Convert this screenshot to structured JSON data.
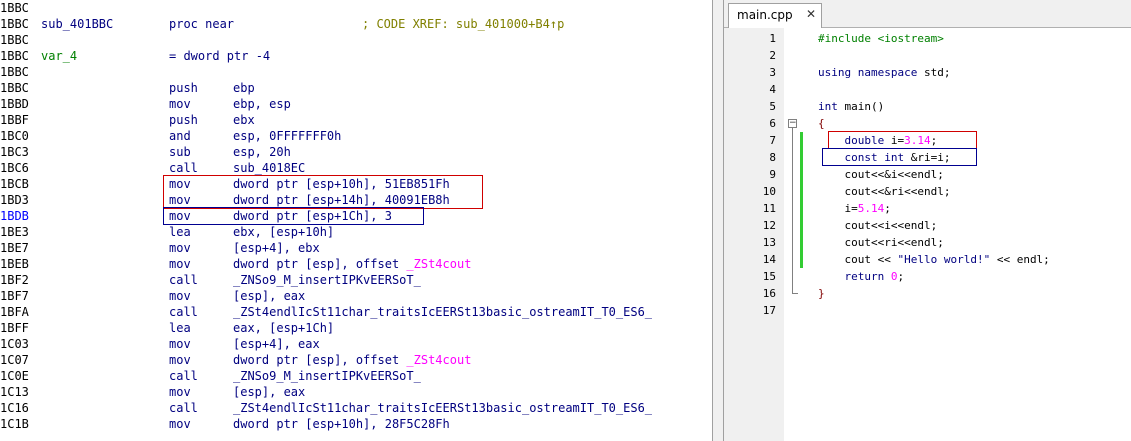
{
  "disassembly": {
    "rows": [
      {
        "addr": "1BBC",
        "label": "",
        "mnemonic": "",
        "operands": "",
        "comment": "",
        "label_type": "none"
      },
      {
        "addr": "1BBC",
        "label": "sub_401BBC",
        "mnemonic": "proc near",
        "operands": "",
        "comment": "; CODE XREF: sub_401000+B4↑p",
        "label_type": "proc"
      },
      {
        "addr": "1BBC",
        "label": "",
        "mnemonic": "",
        "operands": "",
        "comment": "",
        "label_type": "none"
      },
      {
        "addr": "1BBC",
        "label": "var_4",
        "mnemonic": "= dword ptr -4",
        "operands": "",
        "comment": "",
        "label_type": "var"
      },
      {
        "addr": "1BBC",
        "label": "",
        "mnemonic": "",
        "operands": "",
        "comment": "",
        "label_type": "none"
      },
      {
        "addr": "1BBC",
        "label": "",
        "mnemonic": "push",
        "operands": "ebp",
        "comment": "",
        "label_type": "none"
      },
      {
        "addr": "1BBD",
        "label": "",
        "mnemonic": "mov",
        "operands": "ebp, esp",
        "comment": "",
        "label_type": "none"
      },
      {
        "addr": "1BBF",
        "label": "",
        "mnemonic": "push",
        "operands": "ebx",
        "comment": "",
        "label_type": "none"
      },
      {
        "addr": "1BC0",
        "label": "",
        "mnemonic": "and",
        "operands": "esp, 0FFFFFFF0h",
        "comment": "",
        "label_type": "none"
      },
      {
        "addr": "1BC3",
        "label": "",
        "mnemonic": "sub",
        "operands": "esp, 20h",
        "comment": "",
        "label_type": "none"
      },
      {
        "addr": "1BC6",
        "label": "",
        "mnemonic": "call",
        "operands": "sub_4018EC",
        "comment": "",
        "label_type": "none"
      },
      {
        "addr": "1BCB",
        "label": "",
        "mnemonic": "mov",
        "operands": "dword ptr [esp+10h], 51EB851Fh",
        "comment": "",
        "label_type": "none"
      },
      {
        "addr": "1BD3",
        "label": "",
        "mnemonic": "mov",
        "operands": "dword ptr [esp+14h], 40091EB8h",
        "comment": "",
        "label_type": "none"
      },
      {
        "addr": "1BDB",
        "label": "",
        "mnemonic": "mov",
        "operands": "dword ptr [esp+1Ch], 3",
        "comment": "",
        "label_type": "none",
        "addr_blue": true
      },
      {
        "addr": "1BE3",
        "label": "",
        "mnemonic": "lea",
        "operands": "ebx, [esp+10h]",
        "comment": "",
        "label_type": "none"
      },
      {
        "addr": "1BE7",
        "label": "",
        "mnemonic": "mov",
        "operands": "[esp+4], ebx",
        "comment": "",
        "label_type": "none"
      },
      {
        "addr": "1BEB",
        "label": "",
        "mnemonic": "mov",
        "operands": "dword ptr [esp], offset ",
        "import": "_ZSt4cout",
        "comment": "",
        "label_type": "none"
      },
      {
        "addr": "1BF2",
        "label": "",
        "mnemonic": "call",
        "operands": "_ZNSo9_M_insertIPKvEERSoT_",
        "comment": "",
        "label_type": "none"
      },
      {
        "addr": "1BF7",
        "label": "",
        "mnemonic": "mov",
        "operands": "[esp], eax",
        "comment": "",
        "label_type": "none"
      },
      {
        "addr": "1BFA",
        "label": "",
        "mnemonic": "call",
        "operands": "_ZSt4endlIcSt11char_traitsIcEERSt13basic_ostreamIT_T0_ES6_",
        "comment": "",
        "label_type": "none"
      },
      {
        "addr": "1BFF",
        "label": "",
        "mnemonic": "lea",
        "operands": "eax, [esp+1Ch]",
        "comment": "",
        "label_type": "none"
      },
      {
        "addr": "1C03",
        "label": "",
        "mnemonic": "mov",
        "operands": "[esp+4], eax",
        "comment": "",
        "label_type": "none"
      },
      {
        "addr": "1C07",
        "label": "",
        "mnemonic": "mov",
        "operands": "dword ptr [esp], offset ",
        "import": "_ZSt4cout",
        "comment": "",
        "label_type": "none"
      },
      {
        "addr": "1C0E",
        "label": "",
        "mnemonic": "call",
        "operands": "_ZNSo9_M_insertIPKvEERSoT_",
        "comment": "",
        "label_type": "none"
      },
      {
        "addr": "1C13",
        "label": "",
        "mnemonic": "mov",
        "operands": "[esp], eax",
        "comment": "",
        "label_type": "none"
      },
      {
        "addr": "1C16",
        "label": "",
        "mnemonic": "call",
        "operands": "_ZSt4endlIcSt11char_traitsIcEERSt13basic_ostreamIT_T0_ES6_",
        "comment": "",
        "label_type": "none"
      },
      {
        "addr": "1C1B",
        "label": "",
        "mnemonic": "mov",
        "operands": "dword ptr [esp+10h], 28F5C28Fh",
        "comment": "",
        "label_type": "none"
      }
    ]
  },
  "editor": {
    "tab_label": "main.cpp",
    "close_glyph": "✕",
    "lines": [
      {
        "n": "1",
        "parts": [
          {
            "t": "#include <iostream>",
            "c": "pp"
          }
        ]
      },
      {
        "n": "2",
        "parts": []
      },
      {
        "n": "3",
        "parts": [
          {
            "t": "using namespace",
            "c": "kw"
          },
          {
            "t": " std;",
            "c": ""
          }
        ]
      },
      {
        "n": "4",
        "parts": []
      },
      {
        "n": "5",
        "parts": [
          {
            "t": "int",
            "c": "kw"
          },
          {
            "t": " main()",
            "c": ""
          }
        ]
      },
      {
        "n": "6",
        "parts": [
          {
            "t": "{",
            "c": "brace"
          }
        ]
      },
      {
        "n": "7",
        "parts": [
          {
            "t": "    ",
            "c": ""
          },
          {
            "t": "double",
            "c": "kw"
          },
          {
            "t": " i=",
            "c": ""
          },
          {
            "t": "3.14",
            "c": "num"
          },
          {
            "t": ";",
            "c": ""
          }
        ]
      },
      {
        "n": "8",
        "parts": [
          {
            "t": "    ",
            "c": ""
          },
          {
            "t": "const int",
            "c": "kw"
          },
          {
            "t": " &ri=i;",
            "c": ""
          }
        ]
      },
      {
        "n": "9",
        "parts": [
          {
            "t": "    cout<<&i<<endl;",
            "c": ""
          }
        ]
      },
      {
        "n": "10",
        "parts": [
          {
            "t": "    cout<<&ri<<endl;",
            "c": ""
          }
        ]
      },
      {
        "n": "11",
        "parts": [
          {
            "t": "    i=",
            "c": ""
          },
          {
            "t": "5.14",
            "c": "num"
          },
          {
            "t": ";",
            "c": ""
          }
        ]
      },
      {
        "n": "12",
        "parts": [
          {
            "t": "    cout<<i<<endl;",
            "c": ""
          }
        ]
      },
      {
        "n": "13",
        "parts": [
          {
            "t": "    cout<<ri<<endl;",
            "c": ""
          }
        ]
      },
      {
        "n": "14",
        "parts": [
          {
            "t": "    cout << ",
            "c": ""
          },
          {
            "t": "\"Hello world!\"",
            "c": "str"
          },
          {
            "t": " << endl;",
            "c": ""
          }
        ]
      },
      {
        "n": "15",
        "parts": [
          {
            "t": "    ",
            "c": ""
          },
          {
            "t": "return",
            "c": "kw"
          },
          {
            "t": " ",
            "c": ""
          },
          {
            "t": "0",
            "c": "num"
          },
          {
            "t": ";",
            "c": ""
          }
        ]
      },
      {
        "n": "16",
        "parts": [
          {
            "t": "}",
            "c": "brace"
          }
        ]
      },
      {
        "n": "17",
        "parts": []
      }
    ]
  },
  "colors": {
    "asm_text": "#000080",
    "asm_var": "#008000",
    "asm_comment": "#808000",
    "asm_import": "#ff00ff",
    "highlight_red": "#d00000",
    "highlight_blue": "#000090",
    "change_bar": "#33cc33"
  }
}
